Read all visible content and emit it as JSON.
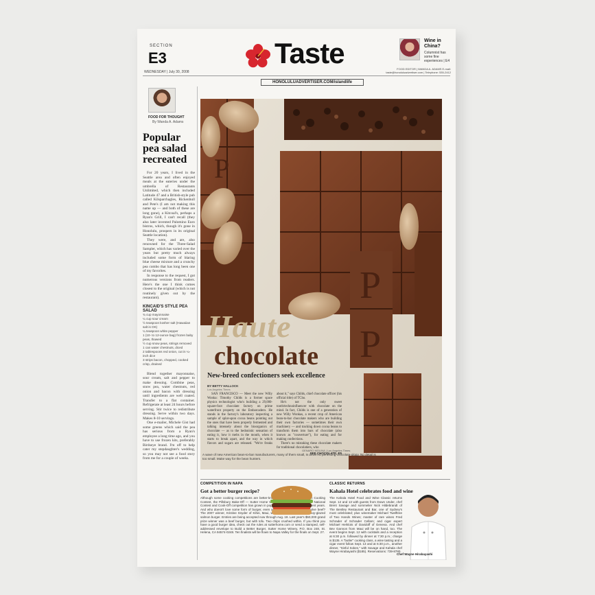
{
  "masthead": {
    "section_label": "SECTION",
    "section_number": "E3",
    "date": "WEDNESDAY  |  July 30, 2008",
    "title": "Taste",
    "site": "HONOLULUADVERTISER.COM/islandlife",
    "teaser_title": "Wine in China?",
    "teaser_text": "Columnist has some fine experiences | E4",
    "editor": "FOOD EDITOR | WANDA A. ADAMS  E-mail: taste@honoluluadvertiser.com | Telephone: 535-2412"
  },
  "left_column": {
    "kicker": "FOOD FOR THOUGHT",
    "byline": "By Wanda A. Adams",
    "headline": "Popular pea salad recreated",
    "paragraphs": [
      "For 20 years, I lived in the Seattle area and often enjoyed meals at the eateries under the umbrella of Restaurants Unlimited, which then included Latitude 47 and a British-style pub called Kilsparchagles, Rickenbull and Pete's (I am not making this name up — and both of these are long gone), a Kitcoal's, perhaps a Ryan's Grill, I can't recall (they also later invented Palomino Euro bistros, which, though it's gone in Honolulu, prospers in its original Seattle location).",
      "They were, and are, also renowned for the Three-Salad Sampler, which has varied over the years but pretty much always included some form of blaring blue cheese mixture and a crunchy pea combo that has long been one of my favorites.",
      "In response to the request, I got numerous versions from readers. Here's the one I think comes closest to the original (which is not routinely given out by the restaurant)."
    ],
    "recipe_title": "KINCAID'S STYLE PEA SALAD",
    "ingredients": [
      "¾ cup mayonnaise",
      "¼ cup sour cream",
      "½ teaspoon kosher salt (Hawaiian salt is OK)",
      "¼ teaspoon white pepper",
      "1 (10- to 12-ounce bag) frozen baby peas, thawed",
      "½ cup snow peas, strings removed",
      "1 can water chestnuts, diced",
      "2 tablespoons red onion, cut in ¼-inch dice",
      "3 strips bacon, chopped, cooked crisp, drained"
    ],
    "method": "Blend together mayonnaise, sour cream, salt and pepper to make dressing. Combine peas, snow pea, water chestnuts, red onion and bacon with dressing until ingredients are well coated. Transfer to a flat container. Refrigerate at least 24 hours before serving. Stir twice to redistribute dressing. Serve within two days. Makes 8-10 servings.",
    "tail": "One e-mailer, Michele Gist had some greens which said the pea has serious from a Ryan's employee a long time ago, and you have to use frozen kits, preferably Birdseye brand. I'm off to help cater my stepdaughter's wedding, so you may not see a food story from me for a couple of weeks."
  },
  "article": {
    "headline_top": "Haute",
    "headline_bottom": "chocolate",
    "deck": "New-breed confectioners seek excellence",
    "byline": "BY BETTY HALLOCK",
    "staff": "Los Angeles Times",
    "paragraphs": [
      "SAN FRANCISCO — Meet the new Willy Wonka: Timothy Childs is a former space physics technologist who's building a 29,000-square-foot chocolate factory on prime waterfront property on the Embarcadero. He stands in the factory's laboratory inspecting a sample of splat-upon cocoa beans pointing out the ones that have been properly fermented and talking intensely about the bioorganics of chocolate — as to the hedonistic sensation of eating it, how it melts in the mouth, when it starts to break apart, and the way in which flavors and sugars are released. \"We're freaks about it,\" says Childs, chief chocolate officer (his official title) of TCho.",
      "He's not the only sweet tooth/technoinfluencer with chocolate on the mind. In fact, Childs is one of a generation of new Willy Wonkas, a recent crop of American bean-to-bar chocolate makers who are building their own factories — sometimes their own machinery — and tracking down cocoa beans to transform them into bars of chocolate (also known as \"couverture\"), for eating and for making confections.",
      "There's no mistaking these chocolate makers for traditional chocolatiers, who"
    ],
    "see_more": "SEE CHOCOLATE, E5",
    "photo_credit": "GENARO MOLINA | Los Angeles Times",
    "caption": "A wave of new American bean-to-bar manufacturers, many of them small, is driven to perfecting chocolate-ology. No detail is too small. Make way for the bean hunters."
  },
  "box_burger": {
    "kicker": "COMPETITION IN NAPA",
    "headline": "Got a better burger recipe?",
    "text": "Although some cooking competitions are better-known — the National Chicken Cooking Contest, the Pillsbury Bake-Off — Sutter Home Winery's Build a Better Burger National Contest and Cook-Off competition has grown in popularity and importance in recent years. And who doesn't love some form of burger, even one that actually doesn't involve beef? The 2007 winner, Kristine Snyder of Kihei, Maui, won the grand prize with a soy-glazed salmon burger. Entries are being accepted now through Aug. 18. Last year's $50,000 grand prize winner was a beef burger, but with tofu. Two chips crushed within. If you think you have a good burger idea, check out the rules at sutterhome.com or send a stamped, self-addressed envelope to Build a Better Burger, Sutter Home Winery, P.O. Box 248, St. Helena, CA 94574-0248. Ten finalists will be flown to Napa Valley for the finals on Sept. 27."
  },
  "box_kahala": {
    "kicker": "CLASSIC RETURNS",
    "headline": "Kahala Hotel celebrates food and wine",
    "text": "The Kahala Hotel Food and Wine Classic returns Sept. 12 and 13 with guests from Down Under, chef Brent Savage and sommelier Nick Hildebrandt of The Bentley Restaurant and Bar, one of Sydney's most celebrated; plus winemaker Michael Twelftree of Two Hands Wines; master of rare wines Fred Schrader of Schrader Cellars; and cigar expert Michael Herklots of Davidoff of Geneva. And chef Bev Gannon from Maui will be on hand, too. The event begins Sept. 12 with cocktails and a reception at 6:30 p.m. followed by dinner at 7:30 p.m.; charge is $135. A \"butler\" cooking class, a wine tasting and a cigar event follow Sept. 13 and at 6:30 p.m., another dinner, \"Sinful Sokes,\" with Savage and Kahala chef Wayne Hirabayashi ($185). Reservations: 739-8780.",
    "photo_caption": "Chef Wayne Hirabayashi"
  },
  "colors": {
    "paper": "#f7f6f3",
    "haute": "#c7b28e",
    "chocolate_headline": "#5a2f1a",
    "hibiscus": "#d7262e"
  },
  "icons": [
    "hibiscus-icon"
  ]
}
